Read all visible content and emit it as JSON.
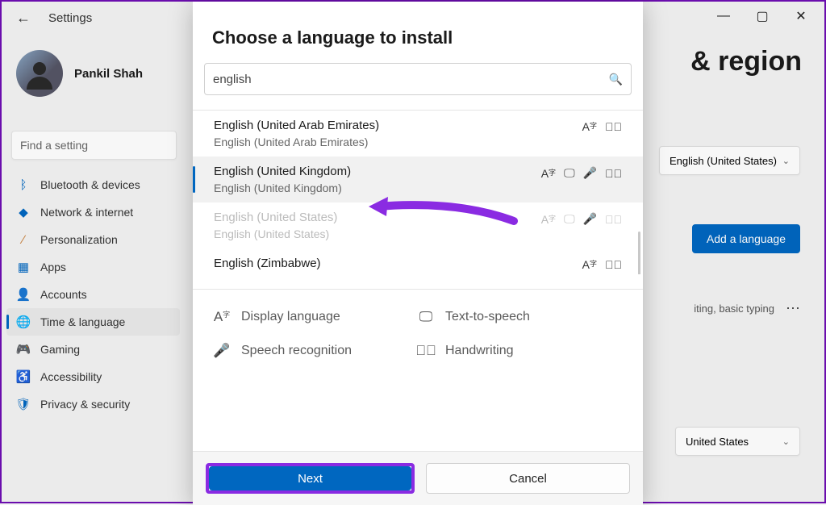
{
  "titlebar": {
    "min": "—",
    "max": "▢",
    "close": "✕"
  },
  "header": {
    "back": "←",
    "title": "Settings"
  },
  "profile": {
    "name": "Pankil Shah"
  },
  "search": {
    "placeholder": "Find a setting"
  },
  "sidebar": {
    "items": [
      {
        "label": "Bluetooth & devices"
      },
      {
        "label": "Network & internet"
      },
      {
        "label": "Personalization"
      },
      {
        "label": "Apps"
      },
      {
        "label": "Accounts"
      },
      {
        "label": "Time & language"
      },
      {
        "label": "Gaming"
      },
      {
        "label": "Accessibility"
      },
      {
        "label": "Privacy & security"
      }
    ],
    "active_index": 5
  },
  "page": {
    "title": "& region"
  },
  "display_language": {
    "value": "English (United States)"
  },
  "add_lang_btn": "Add a language",
  "lang_features_line": "iting, basic typing",
  "country": {
    "value": "United States"
  },
  "dialog": {
    "title": "Choose a language to install",
    "search_value": "english",
    "results": [
      {
        "primary": "English (United Arab Emirates)",
        "secondary": "English (United Arab Emirates)",
        "feat": [
          "display",
          "hand"
        ],
        "state": "normal"
      },
      {
        "primary": "English (United Kingdom)",
        "secondary": "English (United Kingdom)",
        "feat": [
          "display",
          "tts",
          "speech",
          "hand"
        ],
        "state": "selected"
      },
      {
        "primary": "English (United States)",
        "secondary": "English (United States)",
        "feat": [
          "display",
          "tts",
          "speech",
          "hand"
        ],
        "state": "disabled"
      },
      {
        "primary": "English (Zimbabwe)",
        "secondary": "",
        "feat": [
          "display",
          "hand"
        ],
        "state": "normal"
      }
    ],
    "legend": {
      "display": "Display language",
      "tts": "Text-to-speech",
      "speech": "Speech recognition",
      "hand": "Handwriting"
    },
    "next": "Next",
    "cancel": "Cancel"
  }
}
